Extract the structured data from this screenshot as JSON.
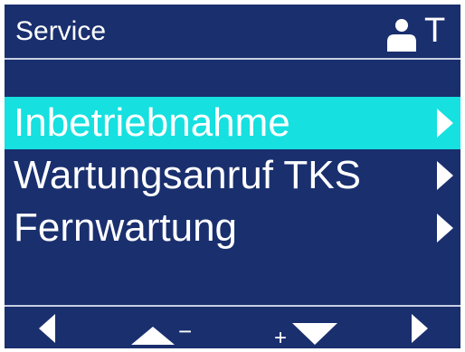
{
  "header": {
    "title": "Service",
    "user_icon": "user-icon",
    "right_text": "T"
  },
  "menu": {
    "items": [
      {
        "label": "Inbetriebnahme",
        "selected": true,
        "arrow_icon": "triangle-right-icon"
      },
      {
        "label": "Wartungsanruf TKS",
        "selected": false,
        "arrow_icon": "triangle-right-icon"
      },
      {
        "label": "Fernwartung",
        "selected": false,
        "arrow_icon": "triangle-right-icon"
      }
    ]
  },
  "softkeys": {
    "left_icon": "triangle-left-icon",
    "up_minus_icon": "triangle-up-minus-icon",
    "plus_down_icon": "plus-triangle-down-icon",
    "right_icon": "triangle-right-icon",
    "minus_symbol": "−",
    "plus_symbol": "+"
  },
  "colors": {
    "background": "#1a2f6e",
    "selection": "#16e0e0",
    "text": "#ffffff",
    "divider": "#c8d0e4"
  }
}
